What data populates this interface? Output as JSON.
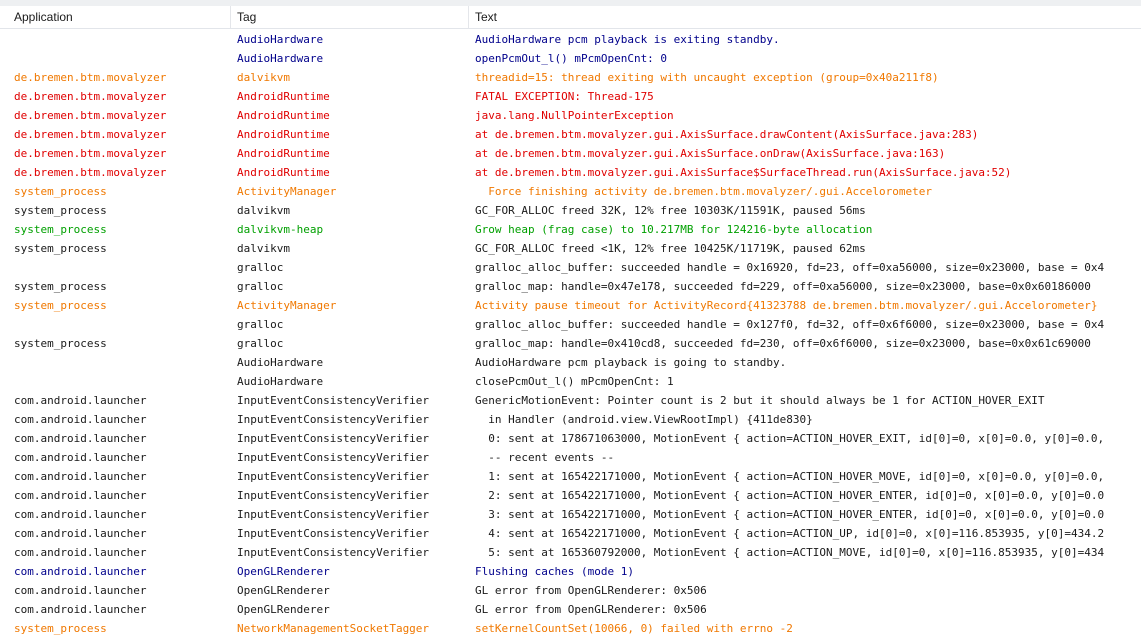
{
  "columns": {
    "application": "Application",
    "tag": "Tag",
    "text": "Text"
  },
  "level_colors": {
    "debug": "#00008b",
    "error": "#e00000",
    "warning": "#f07800",
    "info": "#1a1a1a",
    "verbose": "#00a000"
  },
  "rows": [
    {
      "application": "",
      "tag": "AudioHardware",
      "text": "AudioHardware pcm playback is exiting standby.",
      "level": "debug"
    },
    {
      "application": "",
      "tag": "AudioHardware",
      "text": "openPcmOut_l() mPcmOpenCnt: 0",
      "level": "debug"
    },
    {
      "application": "de.bremen.btm.movalyzer",
      "tag": "dalvikvm",
      "text": "threadid=15: thread exiting with uncaught exception (group=0x40a211f8)",
      "level": "warning"
    },
    {
      "application": "de.bremen.btm.movalyzer",
      "tag": "AndroidRuntime",
      "text": "FATAL EXCEPTION: Thread-175",
      "level": "error"
    },
    {
      "application": "de.bremen.btm.movalyzer",
      "tag": "AndroidRuntime",
      "text": "java.lang.NullPointerException",
      "level": "error"
    },
    {
      "application": "de.bremen.btm.movalyzer",
      "tag": "AndroidRuntime",
      "text": "at de.bremen.btm.movalyzer.gui.AxisSurface.drawContent(AxisSurface.java:283)",
      "level": "error"
    },
    {
      "application": "de.bremen.btm.movalyzer",
      "tag": "AndroidRuntime",
      "text": "at de.bremen.btm.movalyzer.gui.AxisSurface.onDraw(AxisSurface.java:163)",
      "level": "error"
    },
    {
      "application": "de.bremen.btm.movalyzer",
      "tag": "AndroidRuntime",
      "text": "at de.bremen.btm.movalyzer.gui.AxisSurface$SurfaceThread.run(AxisSurface.java:52)",
      "level": "error"
    },
    {
      "application": "system_process",
      "tag": "ActivityManager",
      "text": "  Force finishing activity de.bremen.btm.movalyzer/.gui.Accelorometer",
      "level": "warning"
    },
    {
      "application": "system_process",
      "tag": "dalvikvm",
      "text": "GC_FOR_ALLOC freed 32K, 12% free 10303K/11591K, paused 56ms",
      "level": "info"
    },
    {
      "application": "system_process",
      "tag": "dalvikvm-heap",
      "text": "Grow heap (frag case) to 10.217MB for 124216-byte allocation",
      "level": "verbose"
    },
    {
      "application": "system_process",
      "tag": "dalvikvm",
      "text": "GC_FOR_ALLOC freed <1K, 12% free 10425K/11719K, paused 62ms",
      "level": "info"
    },
    {
      "application": "",
      "tag": "gralloc",
      "text": "gralloc_alloc_buffer: succeeded handle = 0x16920, fd=23, off=0xa56000, size=0x23000, base = 0x4",
      "level": "info"
    },
    {
      "application": "system_process",
      "tag": "gralloc",
      "text": "gralloc_map: handle=0x47e178, succeeded fd=229, off=0xa56000, size=0x23000, base=0x0x60186000",
      "level": "info"
    },
    {
      "application": "system_process",
      "tag": "ActivityManager",
      "text": "Activity pause timeout for ActivityRecord{41323788 de.bremen.btm.movalyzer/.gui.Accelorometer}",
      "level": "warning"
    },
    {
      "application": "",
      "tag": "gralloc",
      "text": "gralloc_alloc_buffer: succeeded handle = 0x127f0, fd=32, off=0x6f6000, size=0x23000, base = 0x4",
      "level": "info"
    },
    {
      "application": "system_process",
      "tag": "gralloc",
      "text": "gralloc_map: handle=0x410cd8, succeeded fd=230, off=0x6f6000, size=0x23000, base=0x0x61c69000",
      "level": "info"
    },
    {
      "application": "",
      "tag": "AudioHardware",
      "text": "AudioHardware pcm playback is going to standby.",
      "level": "info"
    },
    {
      "application": "",
      "tag": "AudioHardware",
      "text": "closePcmOut_l() mPcmOpenCnt: 1",
      "level": "info"
    },
    {
      "application": "com.android.launcher",
      "tag": "InputEventConsistencyVerifier",
      "text": "GenericMotionEvent: Pointer count is 2 but it should always be 1 for ACTION_HOVER_EXIT",
      "level": "info"
    },
    {
      "application": "com.android.launcher",
      "tag": "InputEventConsistencyVerifier",
      "text": "  in Handler (android.view.ViewRootImpl) {411de830}",
      "level": "info"
    },
    {
      "application": "com.android.launcher",
      "tag": "InputEventConsistencyVerifier",
      "text": "  0: sent at 178671063000, MotionEvent { action=ACTION_HOVER_EXIT, id[0]=0, x[0]=0.0, y[0]=0.0,",
      "level": "info"
    },
    {
      "application": "com.android.launcher",
      "tag": "InputEventConsistencyVerifier",
      "text": "  -- recent events --",
      "level": "info"
    },
    {
      "application": "com.android.launcher",
      "tag": "InputEventConsistencyVerifier",
      "text": "  1: sent at 165422171000, MotionEvent { action=ACTION_HOVER_MOVE, id[0]=0, x[0]=0.0, y[0]=0.0,",
      "level": "info"
    },
    {
      "application": "com.android.launcher",
      "tag": "InputEventConsistencyVerifier",
      "text": "  2: sent at 165422171000, MotionEvent { action=ACTION_HOVER_ENTER, id[0]=0, x[0]=0.0, y[0]=0.0",
      "level": "info"
    },
    {
      "application": "com.android.launcher",
      "tag": "InputEventConsistencyVerifier",
      "text": "  3: sent at 165422171000, MotionEvent { action=ACTION_HOVER_ENTER, id[0]=0, x[0]=0.0, y[0]=0.0",
      "level": "info"
    },
    {
      "application": "com.android.launcher",
      "tag": "InputEventConsistencyVerifier",
      "text": "  4: sent at 165422171000, MotionEvent { action=ACTION_UP, id[0]=0, x[0]=116.853935, y[0]=434.2",
      "level": "info"
    },
    {
      "application": "com.android.launcher",
      "tag": "InputEventConsistencyVerifier",
      "text": "  5: sent at 165360792000, MotionEvent { action=ACTION_MOVE, id[0]=0, x[0]=116.853935, y[0]=434",
      "level": "info"
    },
    {
      "application": "com.android.launcher",
      "tag": "OpenGLRenderer",
      "text": "Flushing caches (mode 1)",
      "level": "debug"
    },
    {
      "application": "com.android.launcher",
      "tag": "OpenGLRenderer",
      "text": "GL error from OpenGLRenderer: 0x506",
      "level": "info"
    },
    {
      "application": "com.android.launcher",
      "tag": "OpenGLRenderer",
      "text": "GL error from OpenGLRenderer: 0x506",
      "level": "info"
    },
    {
      "application": "system_process",
      "tag": "NetworkManagementSocketTagger",
      "text": "setKernelCountSet(10066, 0) failed with errno -2",
      "level": "warning"
    }
  ]
}
